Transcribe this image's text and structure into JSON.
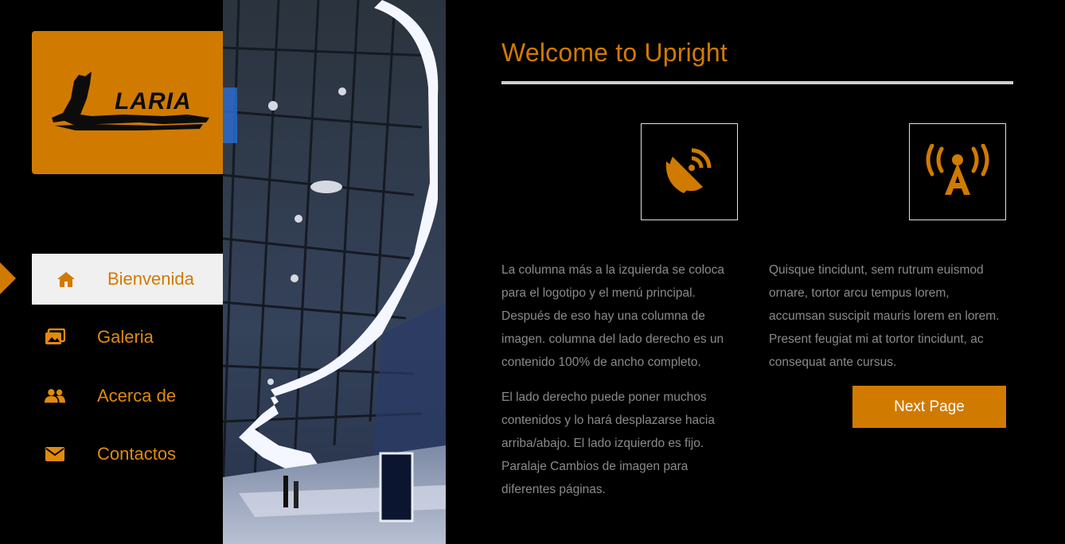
{
  "brand": {
    "logo_text": "LARIA",
    "accent_color": "#d17a00"
  },
  "nav": {
    "items": [
      {
        "label": "Bienvenida",
        "icon": "home-icon",
        "active": true
      },
      {
        "label": "Galeria",
        "icon": "images-icon",
        "active": false
      },
      {
        "label": "Acerca de",
        "icon": "users-icon",
        "active": false
      },
      {
        "label": "Contactos",
        "icon": "envelope-icon",
        "active": false
      }
    ]
  },
  "main": {
    "title": "Welcome to Upright",
    "icons": [
      "satellite-dish-icon",
      "broadcast-tower-icon"
    ],
    "col1": {
      "p1": "La columna más a la izquierda se coloca para el logotipo y el menú principal. Después de eso hay una columna de imagen. columna del lado derecho es un contenido 100% de ancho completo.",
      "p2": "El lado derecho puede poner muchos contenidos y lo hará desplazarse hacia arriba/abajo. El lado izquierdo es fijo. Paralaje Cambios de imagen para diferentes páginas."
    },
    "col2": {
      "p1": "Quisque tincidunt, sem rutrum euismod ornare, tortor arcu tempus lorem, accumsan suscipit mauris lorem en lorem. Present feugiat mi at tortor tincidunt, ac consequat ante cursus."
    },
    "next_button": "Next Page"
  }
}
